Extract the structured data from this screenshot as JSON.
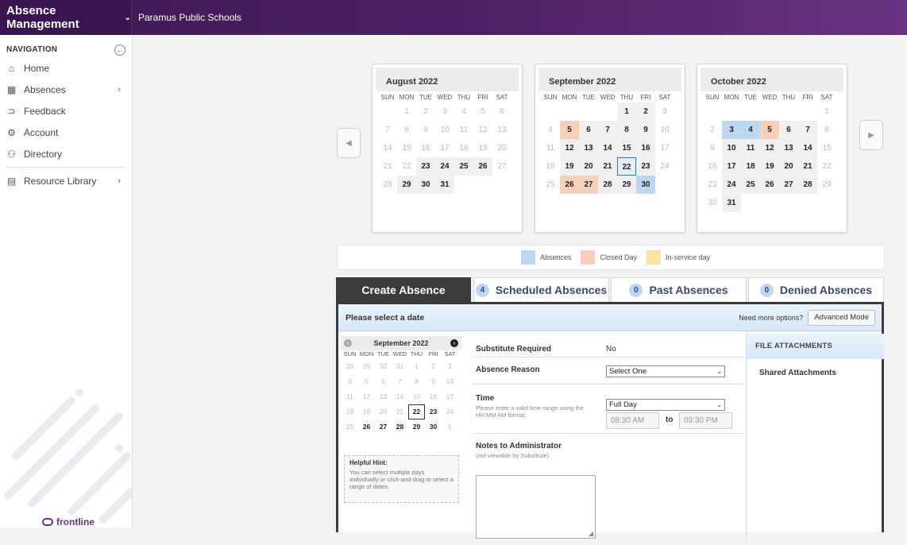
{
  "header": {
    "app_title": "Absence Management",
    "org_name": "Paramus Public Schools"
  },
  "sidebar": {
    "heading": "NAVIGATION",
    "items": [
      {
        "label": "Home",
        "icon": "home-icon",
        "glyph": "⌂",
        "arrow": ""
      },
      {
        "label": "Absences",
        "icon": "calendar-icon",
        "glyph": "▦",
        "arrow": "›"
      },
      {
        "label": "Feedback",
        "icon": "feedback-icon",
        "glyph": "⊃",
        "arrow": ""
      },
      {
        "label": "Account",
        "icon": "gear-icon",
        "glyph": "⚙",
        "arrow": ""
      },
      {
        "label": "Directory",
        "icon": "people-icon",
        "glyph": "⚇",
        "arrow": ""
      },
      {
        "label": "Resource Library",
        "icon": "library-icon",
        "glyph": "▤",
        "arrow": "›"
      }
    ],
    "brand": "frontline"
  },
  "calendars": {
    "weekdays": [
      "SUN",
      "MON",
      "TUE",
      "WED",
      "THU",
      "FRI",
      "SAT"
    ],
    "months": [
      {
        "title": "August 2022",
        "days": [
          [
            "",
            "f"
          ],
          [
            "1",
            "m"
          ],
          [
            "2",
            "m"
          ],
          [
            "3",
            "m"
          ],
          [
            "4",
            "m"
          ],
          [
            "5",
            "m"
          ],
          [
            "6",
            "m"
          ],
          [
            "7",
            "m"
          ],
          [
            "8",
            "m"
          ],
          [
            "9",
            "m"
          ],
          [
            "10",
            "m"
          ],
          [
            "11",
            "m"
          ],
          [
            "12",
            "m"
          ],
          [
            "13",
            "m"
          ],
          [
            "14",
            "m"
          ],
          [
            "15",
            "m"
          ],
          [
            "16",
            "m"
          ],
          [
            "17",
            "m"
          ],
          [
            "18",
            "m"
          ],
          [
            "19",
            "m"
          ],
          [
            "20",
            "m"
          ],
          [
            "21",
            "m"
          ],
          [
            "22",
            "m"
          ],
          [
            "23",
            "b"
          ],
          [
            "24",
            "b"
          ],
          [
            "25",
            "b"
          ],
          [
            "26",
            "b"
          ],
          [
            "27",
            "m"
          ],
          [
            "28",
            "m"
          ],
          [
            "29",
            "b"
          ],
          [
            "30",
            "b"
          ],
          [
            "31",
            "b"
          ],
          [
            "",
            "e"
          ],
          [
            "",
            "e"
          ],
          [
            "",
            "e"
          ]
        ]
      },
      {
        "title": "September 2022",
        "days": [
          [
            "",
            "e"
          ],
          [
            "",
            "e"
          ],
          [
            "",
            "e"
          ],
          [
            "",
            "e"
          ],
          [
            "1",
            "b"
          ],
          [
            "2",
            "b"
          ],
          [
            "3",
            "m"
          ],
          [
            "4",
            "m"
          ],
          [
            "5",
            "cls"
          ],
          [
            "6",
            "b"
          ],
          [
            "7",
            "b"
          ],
          [
            "8",
            "b"
          ],
          [
            "9",
            "b"
          ],
          [
            "10",
            "m"
          ],
          [
            "11",
            "m"
          ],
          [
            "12",
            "b"
          ],
          [
            "13",
            "b"
          ],
          [
            "14",
            "b"
          ],
          [
            "15",
            "b"
          ],
          [
            "16",
            "b"
          ],
          [
            "17",
            "m"
          ],
          [
            "18",
            "m"
          ],
          [
            "19",
            "b"
          ],
          [
            "20",
            "b"
          ],
          [
            "21",
            "b"
          ],
          [
            "22",
            "today"
          ],
          [
            "23",
            "b"
          ],
          [
            "24",
            "m"
          ],
          [
            "25",
            "m"
          ],
          [
            "26",
            "cls"
          ],
          [
            "27",
            "cls"
          ],
          [
            "28",
            "b"
          ],
          [
            "29",
            "b"
          ],
          [
            "30",
            "abs"
          ],
          [
            "",
            "e"
          ]
        ]
      },
      {
        "title": "October 2022",
        "days": [
          [
            "",
            "e"
          ],
          [
            "",
            "e"
          ],
          [
            "",
            "e"
          ],
          [
            "",
            "e"
          ],
          [
            "",
            "e"
          ],
          [
            "",
            "e"
          ],
          [
            "1",
            "m"
          ],
          [
            "2",
            "m"
          ],
          [
            "3",
            "abs"
          ],
          [
            "4",
            "abs"
          ],
          [
            "5",
            "cls"
          ],
          [
            "6",
            "b"
          ],
          [
            "7",
            "b"
          ],
          [
            "8",
            "m"
          ],
          [
            "9",
            "m"
          ],
          [
            "10",
            "b"
          ],
          [
            "11",
            "b"
          ],
          [
            "12",
            "b"
          ],
          [
            "13",
            "b"
          ],
          [
            "14",
            "b"
          ],
          [
            "15",
            "m"
          ],
          [
            "16",
            "m"
          ],
          [
            "17",
            "b"
          ],
          [
            "18",
            "b"
          ],
          [
            "19",
            "b"
          ],
          [
            "20",
            "b"
          ],
          [
            "21",
            "b"
          ],
          [
            "22",
            "m"
          ],
          [
            "23",
            "m"
          ],
          [
            "24",
            "b"
          ],
          [
            "25",
            "b"
          ],
          [
            "26",
            "b"
          ],
          [
            "27",
            "b"
          ],
          [
            "28",
            "b"
          ],
          [
            "29",
            "m"
          ],
          [
            "30",
            "m"
          ],
          [
            "31",
            "b"
          ]
        ]
      }
    ]
  },
  "legend": {
    "items": [
      {
        "label": "Absences",
        "color": "#bcd7ef"
      },
      {
        "label": "Closed Day",
        "color": "#f7d0bc"
      },
      {
        "label": "In-service day",
        "color": "#fbe3a4"
      }
    ]
  },
  "tabs": [
    {
      "label": "Create Absence",
      "count": ""
    },
    {
      "label": "Scheduled Absences",
      "count": "4"
    },
    {
      "label": "Past Absences",
      "count": "0"
    },
    {
      "label": "Denied Absences",
      "count": "0"
    }
  ],
  "panel": {
    "title": "Please select a date",
    "more_options": "Need more options?",
    "advanced_button": "Advanced Mode",
    "mini_calendar": {
      "title": "September 2022",
      "weekdays": [
        "SUN",
        "MON",
        "TUE",
        "WED",
        "THU",
        "FRI",
        "SAT"
      ],
      "days": [
        [
          "28",
          "m"
        ],
        [
          "29",
          "m"
        ],
        [
          "30",
          "m"
        ],
        [
          "31",
          "m"
        ],
        [
          "1",
          "m"
        ],
        [
          "2",
          "m"
        ],
        [
          "3",
          "m"
        ],
        [
          "4",
          "m"
        ],
        [
          "5",
          "m"
        ],
        [
          "6",
          "m"
        ],
        [
          "7",
          "m"
        ],
        [
          "8",
          "m"
        ],
        [
          "9",
          "m"
        ],
        [
          "10",
          "m"
        ],
        [
          "11",
          "m"
        ],
        [
          "12",
          "m"
        ],
        [
          "13",
          "m"
        ],
        [
          "14",
          "m"
        ],
        [
          "15",
          "m"
        ],
        [
          "16",
          "m"
        ],
        [
          "17",
          "m"
        ],
        [
          "18",
          "m"
        ],
        [
          "19",
          "m"
        ],
        [
          "20",
          "m"
        ],
        [
          "21",
          "m"
        ],
        [
          "22",
          "today"
        ],
        [
          "23",
          "b"
        ],
        [
          "24",
          "m"
        ],
        [
          "25",
          "m"
        ],
        [
          "26",
          "b"
        ],
        [
          "27",
          "b"
        ],
        [
          "28",
          "b"
        ],
        [
          "29",
          "b"
        ],
        [
          "30",
          "b"
        ],
        [
          "1",
          "m"
        ]
      ]
    },
    "hint_title": "Helpful Hint:",
    "hint_text": "You can select multiple days individually or click-and-drag to select a range of dates.",
    "form": {
      "substitute_label": "Substitute Required",
      "substitute_value": "No",
      "reason_label": "Absence Reason",
      "reason_value": "Select One",
      "time_label": "Time",
      "time_help": "Please enter a valid time range using the HH:MM AM format.",
      "time_value": "Full Day",
      "start_time": "08:30 AM",
      "to_label": "to",
      "end_time": "03:30 PM",
      "notes_label": "Notes to Administrator",
      "notes_help": "(not viewable by Substitute)"
    },
    "attachments_title": "FILE ATTACHMENTS",
    "shared_attachments": "Shared Attachments"
  }
}
